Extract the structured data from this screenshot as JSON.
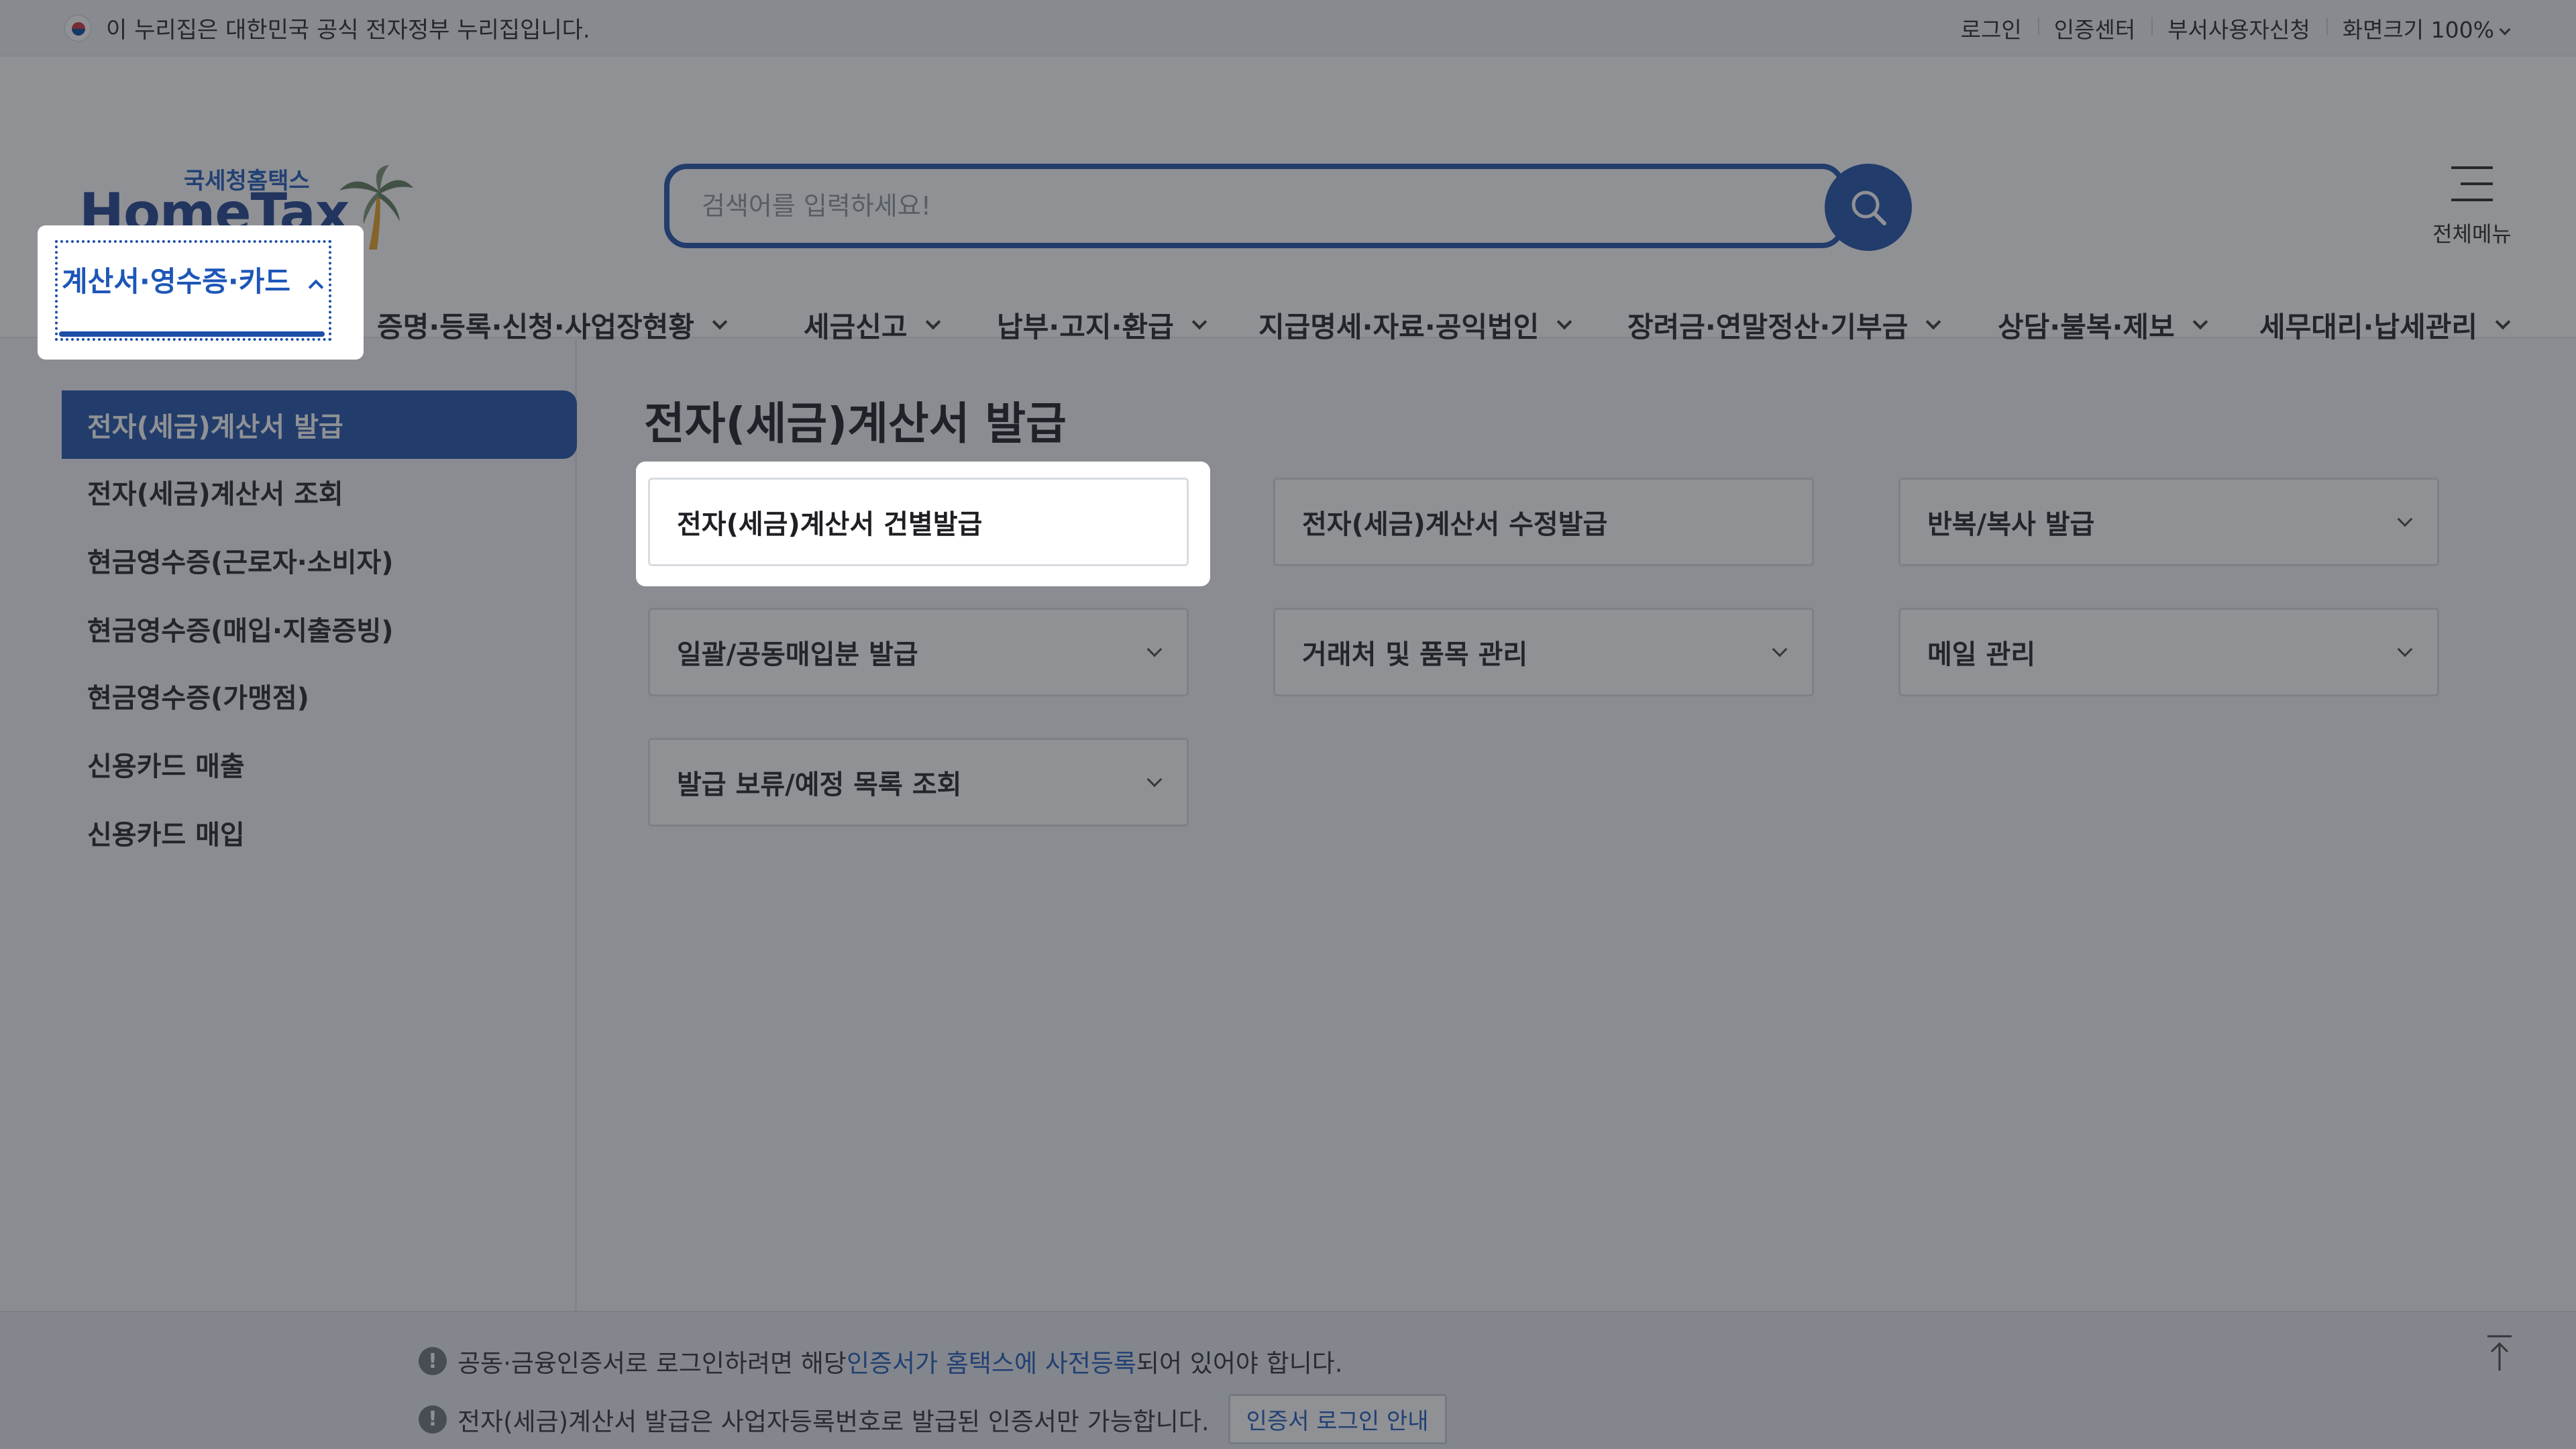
{
  "gov_banner": {
    "text": "이 누리집은 대한민국 공식 전자정부 누리집입니다.",
    "links": [
      "로그인",
      "인증센터",
      "부서사용자신청"
    ],
    "zoom_label": "화면크기 100%"
  },
  "logo": {
    "sub": "국세청홈택스",
    "main": "HomeTax"
  },
  "search": {
    "placeholder": "검색어를 입력하세요!"
  },
  "all_menu": {
    "label": "전체메뉴"
  },
  "gnb": {
    "active": "계산서·영수증·카드",
    "items": [
      "증명·등록·신청·사업장현황",
      "세금신고",
      "납부·고지·환급",
      "지급명세·자료·공익법인",
      "장려금·연말정산·기부금",
      "상담·불복·제보",
      "세무대리·납세관리"
    ]
  },
  "lnb": {
    "items": [
      "전자(세금)계산서 발급",
      "전자(세금)계산서 조회",
      "현금영수증(근로자·소비자)",
      "현금영수증(매입·지출증빙)",
      "현금영수증(가맹점)",
      "신용카드 매출",
      "신용카드 매입"
    ]
  },
  "content": {
    "title": "전자(세금)계산서 발급",
    "cards": [
      "전자(세금)계산서 건별발급",
      "전자(세금)계산서 수정발급",
      "반복/복사 발급",
      "일괄/공동매입분 발급",
      "거래처 및 품목 관리",
      "메일 관리",
      "발급 보류/예정 목록 조회"
    ]
  },
  "footer": {
    "notice1_pre": "공동·금융인증서로 로그인하려면 해당 ",
    "notice1_link": "인증서가 홈택스에 사전등록",
    "notice1_post": "되어 있어야 합니다.",
    "notice2": "전자(세금)계산서 발급은 사업자등록번호로 발급된 인증서만 가능합니다.",
    "notice2_button": "인증서 로그인 안내"
  },
  "colors": {
    "brand": "#1d4ea8",
    "link": "#1d56b8"
  }
}
